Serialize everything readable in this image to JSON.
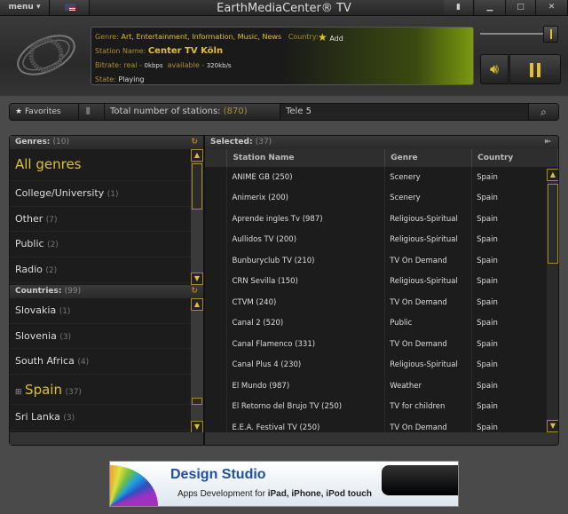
{
  "window": {
    "title": "EarthMediaCenter® TV",
    "menu_label": "menu ▾",
    "flag_icon": "us-flag-icon"
  },
  "info": {
    "genre_label": "Genre:",
    "genre_value": "Art, Entertainment, Information, Music, News",
    "country_label": "Country:",
    "add_label": "Add",
    "station_label": "Station Name:",
    "station_value": "Center TV Köln",
    "bitrate_label": "Bitrate: real -",
    "bitrate_real": "0kbps",
    "available_label": "available -",
    "available_value": "320kb/s",
    "state_label": "State:",
    "state_value": "Playing"
  },
  "player": {
    "volume": 0.9,
    "accent": "#e0c030"
  },
  "toolbar": {
    "favorites_label": "Favorites",
    "total_label": "Total number of stations:",
    "total_count": "(870)",
    "search_value": "Tele 5"
  },
  "genres": {
    "title": "Genres:",
    "count": "(10)",
    "items": [
      {
        "label": "All genres",
        "count": ""
      },
      {
        "label": "College/University",
        "count": "(1)"
      },
      {
        "label": "Other",
        "count": "(7)"
      },
      {
        "label": "Public",
        "count": "(2)"
      },
      {
        "label": "Radio",
        "count": "(2)"
      }
    ]
  },
  "countries": {
    "title": "Countries:",
    "count": "(99)",
    "items": [
      {
        "label": "Slovakia",
        "count": "(1)"
      },
      {
        "label": "Slovenia",
        "count": "(3)"
      },
      {
        "label": "South Africa",
        "count": "(4)"
      },
      {
        "label": "Spain",
        "count": "(37)"
      },
      {
        "label": "Sri Lanka",
        "count": "(3)"
      }
    ]
  },
  "selected": {
    "title": "Selected:",
    "count": "(37)",
    "columns": [
      "Station Name",
      "Genre",
      "Country"
    ],
    "rows": [
      [
        "ANIME GB (250)",
        "Scenery",
        "Spain"
      ],
      [
        "Animerix (200)",
        "Scenery",
        "Spain"
      ],
      [
        "Aprende ingles Tv (987)",
        "Religious-Spiritual",
        "Spain"
      ],
      [
        "Aullidos TV (200)",
        "Religious-Spiritual",
        "Spain"
      ],
      [
        "Bunburyclub TV (210)",
        "TV On Demand",
        "Spain"
      ],
      [
        "CRN Sevilla (150)",
        "Religious-Spiritual",
        "Spain"
      ],
      [
        "CTVM (240)",
        "TV On Demand",
        "Spain"
      ],
      [
        "Canal 2 (520)",
        "Public",
        "Spain"
      ],
      [
        "Canal Flamenco (331)",
        "TV On Demand",
        "Spain"
      ],
      [
        "Canal Plus 4 (230)",
        "Religious-Spiritual",
        "Spain"
      ],
      [
        "El Mundo (987)",
        "Weather",
        "Spain"
      ],
      [
        "El Retorno del Brujo TV (250)",
        "TV for children",
        "Spain"
      ],
      [
        "E.E.A. Festival TV (250)",
        "TV On Demand",
        "Spain"
      ]
    ]
  },
  "ad": {
    "title": "Design Studio",
    "subtitle_prefix": "Apps Development for ",
    "subtitle_bold": "iPad, iPhone, iPod touch"
  }
}
